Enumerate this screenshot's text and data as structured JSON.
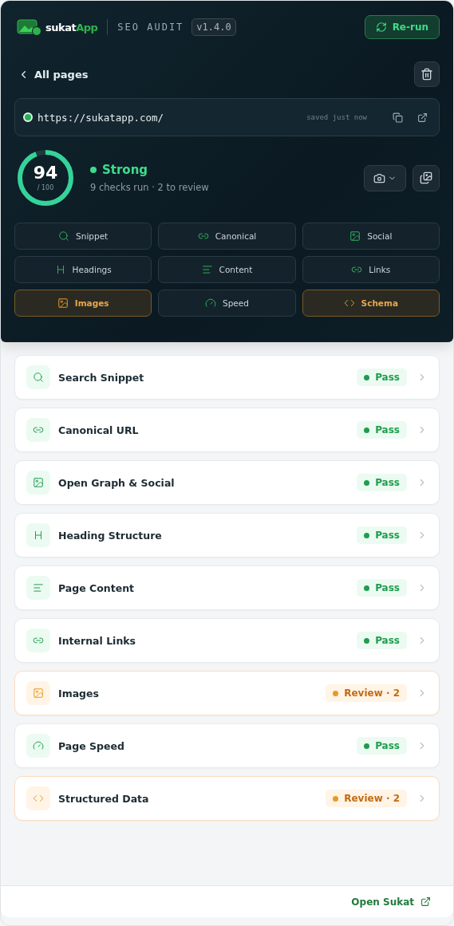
{
  "header": {
    "logo": {
      "primary": "sukat",
      "accent": "App"
    },
    "title": "SEO AUDIT",
    "version": "v1.4.0",
    "rerun_button": "Re-run"
  },
  "nav": {
    "back_link": "All pages"
  },
  "url_bar": {
    "url": "https://sukatapp.com/",
    "saved": "saved just now"
  },
  "score": {
    "value": "94",
    "max": "/ 100",
    "level": 0.94,
    "rating": "Strong",
    "summary": "9 checks run · 2 to review"
  },
  "tiles": [
    {
      "label": "Snippet",
      "kind": "search",
      "flagged": false
    },
    {
      "label": "Canonical",
      "kind": "link",
      "flagged": false
    },
    {
      "label": "Social",
      "kind": "image",
      "flagged": false
    },
    {
      "label": "Headings",
      "kind": "heading",
      "flagged": false
    },
    {
      "label": "Content",
      "kind": "lines",
      "flagged": false
    },
    {
      "label": "Links",
      "kind": "link",
      "flagged": false
    },
    {
      "label": "Images",
      "kind": "image",
      "flagged": true
    },
    {
      "label": "Speed",
      "kind": "gauge",
      "flagged": false
    },
    {
      "label": "Schema",
      "kind": "code",
      "flagged": true
    }
  ],
  "checks": [
    {
      "title": "Search Snippet",
      "kind": "search",
      "flagged": false,
      "badge": "Pass"
    },
    {
      "title": "Canonical URL",
      "kind": "link",
      "flagged": false,
      "badge": "Pass"
    },
    {
      "title": "Open Graph & Social",
      "kind": "image",
      "flagged": false,
      "badge": "Pass"
    },
    {
      "title": "Heading Structure",
      "kind": "heading",
      "flagged": false,
      "badge": "Pass"
    },
    {
      "title": "Page Content",
      "kind": "lines",
      "flagged": false,
      "badge": "Pass"
    },
    {
      "title": "Internal Links",
      "kind": "link",
      "flagged": false,
      "badge": "Pass"
    },
    {
      "title": "Images",
      "kind": "image",
      "flagged": true,
      "badge": "Review · 2"
    },
    {
      "title": "Page Speed",
      "kind": "gauge",
      "flagged": false,
      "badge": "Pass"
    },
    {
      "title": "Structured Data",
      "kind": "code",
      "flagged": true,
      "badge": "Review · 2"
    }
  ],
  "footer": {
    "link": "Open Sukat"
  }
}
